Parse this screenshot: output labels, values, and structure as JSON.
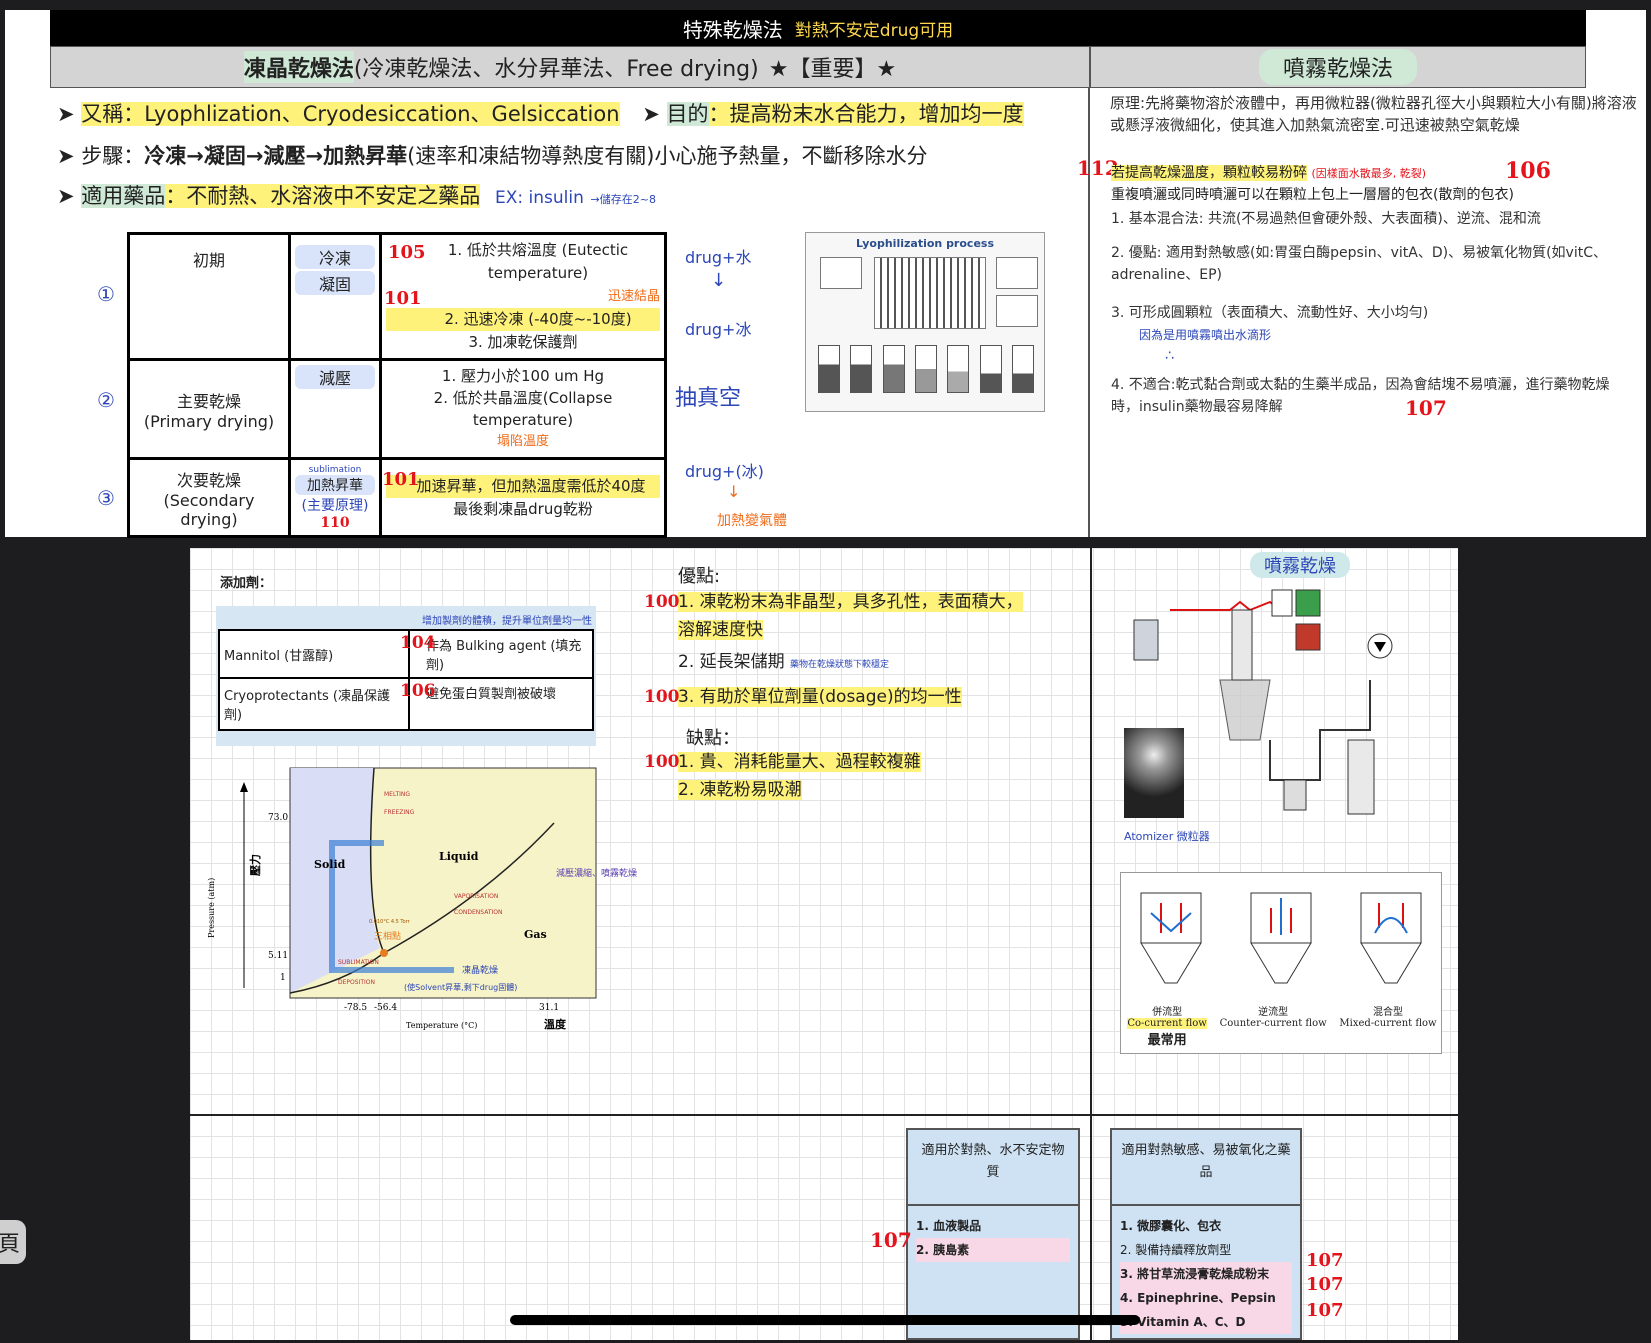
{
  "top": {
    "title": "特殊乾燥法",
    "title_note": "對熱不安定drug可用",
    "lyo_header_main": "凍晶乾燥法",
    "lyo_header_alt": "(冷凍乾燥法、水分昇華法、Free drying)",
    "lyo_header_star": "★【重要】★",
    "spray_header": "噴霧乾燥法",
    "alias_label": "又稱：",
    "alias_text": "Lyophlization、Cryodesiccation、Gelsiccation",
    "purpose_label": "目的",
    "purpose_text": "：提高粉末水合能力，增加均一度",
    "steps_label": "步驟：",
    "steps_bold": "冷凍→凝固→減壓→加熱昇華",
    "steps_rest": "(速率和凍結物導熱度有關)小心施予熱量，不斷移除水分",
    "drugs_label": "適用藥品",
    "drugs_text": "：不耐熱、水溶液中不安定之藥品",
    "drugs_note": "EX: insulin",
    "drugs_note2": "→儲存在2~8",
    "table": {
      "rows": [
        {
          "num": "①",
          "phase": "初期",
          "step1": "冷凍",
          "step2": "凝固",
          "note_num1": "105",
          "note_num2": "101",
          "desc1": "1. 低於共熔溫度 (Eutectic temperature)",
          "desc1_note": "迅速結晶",
          "desc2": "2. 迅速冷凍 (-40度~-10度)",
          "desc3": "3. 加凍乾保護劑"
        },
        {
          "num": "②",
          "phase": "主要乾燥",
          "phase2": "(Primary drying)",
          "step1": "減壓",
          "desc1": "1. 壓力小於100 um Hg",
          "desc2": "2. 低於共晶溫度(Collapse temperature)",
          "desc2_note": "塌陷溫度"
        },
        {
          "num": "③",
          "phase": "次要乾燥",
          "phase2": "(Secondary drying)",
          "step1": "加熱昇華",
          "step1_note": "sublimation",
          "step2": "(主要原理)",
          "step_num": "110",
          "note_num": "101",
          "desc1": "加速昇華，但加熱溫度需低於40度",
          "desc2": "最後剩凍晶drug乾粉"
        }
      ]
    },
    "drug_ice": "drug+冰",
    "drug_water": "drug+水",
    "vacuum_note": "抽真空",
    "drug_ice2": "drug+(冰)",
    "heat_note": "加熱變氣體",
    "lyo_process_title": "Lyophilization process",
    "spray": {
      "principle": "原理:先將藥物溶於液體中，再用微粒器(微粒器孔徑大小與顆粒大小有關)將溶液或懸浮液微細化，使其進入加熱氣流密室.可迅速被熱空氣乾燥",
      "num112": "112",
      "temp_note": "若提高乾燥溫度，顆粒較易粉碎",
      "temp_note_sm": "(因樣面水散最多, 乾裂)",
      "num106": "106",
      "coat_text": "重複噴灑或同時噴灑可以在顆粒上包上一層層的包衣(散劑的包衣)",
      "item1": "1.  基本混合法: 共流(不易過熱但會硬外殼、大表面積)、逆流、混和流",
      "item2": "2.  優點: 適用對熱敏感(如:胃蛋白酶pepsin、vitA、D)、易被氧化物質(如vitC、adrenaline、EP)",
      "item3": "3.  可形成圓顆粒（表面積大、流動性好、大小均勻)",
      "item3_note": "因為是用噴霧噴出水滴形",
      "item4": "4.  不適合:乾式黏合劑或太黏的生藥半成品，因為會結塊不易噴灑，進行藥物乾燥時，insulin藥物最容易降解",
      "num107": "107"
    }
  },
  "bottom": {
    "additive_title": "添加劑：",
    "additive_note": "增加製劑的體積，提升單位劑量均一性",
    "additive_rows": [
      {
        "name": "Mannitol (甘露醇)",
        "num": "104",
        "desc": "作為 Bulking agent (填充劑)"
      },
      {
        "name": "Cryoprotectants (凍晶保護劑)",
        "num": "106",
        "desc": "避免蛋白質製劑被破壞"
      }
    ],
    "phase": {
      "ylabel": "Pressure (atm)",
      "ylabel_note": "壓力",
      "xlabel": "Temperature (°C)",
      "xlabel_note": "溫度",
      "y_ticks": [
        "73.0",
        "5.11",
        "1"
      ],
      "x_ticks": [
        "-78.5",
        "-56.4",
        "31.1"
      ],
      "region_solid": "Solid",
      "region_liquid": "Liquid",
      "region_gas": "Gas",
      "melting": "MELTING",
      "freezing": "FREEZING",
      "vaporisation": "VAPORISATION",
      "condensation": "CONDENSATION",
      "sublimation": "SUBLIMATION",
      "deposition": "DEPOSITION",
      "triple_point": "三相點",
      "triple_label": "0.010°C 4.5 Torr",
      "note_liquid": "減壓濃縮、噴霧乾燥",
      "note_sub": "凍晶乾燥",
      "note_sub2": "(使Solvent昇華,剩下drug固體)"
    },
    "adv_title": "優點:",
    "adv": [
      {
        "num": "100",
        "text": "1.  凍乾粉末為非晶型，具多孔性，表面積大，溶解速度快"
      },
      {
        "num": "",
        "text": "2.  延長架儲期",
        "note": "藥物在乾燥狀態下較穩定"
      },
      {
        "num": "100",
        "text": "3.  有助於單位劑量(dosage)的均一性"
      }
    ],
    "dis_title": "缺點：",
    "dis": [
      {
        "num": "100",
        "text": "1.  貴、消耗能量大、過程較複雜"
      },
      {
        "num": "",
        "text": "2.  凍乾粉易吸潮"
      }
    ],
    "spray_title": "噴霧乾燥",
    "atomizer": "Atomizer 微粒器",
    "flow_types": [
      {
        "zh": "併流型",
        "en": "Co-current flow",
        "note": "最常用"
      },
      {
        "zh": "逆流型",
        "en": "Counter-current flow",
        "note": ""
      },
      {
        "zh": "混合型",
        "en": "Mixed-current flow",
        "note": ""
      }
    ],
    "table_left_title": "適用於對熱、水不安定物質",
    "table_left_items": [
      "1. 血液製品",
      "2. 胰島素"
    ],
    "table_left_num": "107",
    "table_right_title": "適用對熱敏感、易被氧化之藥品",
    "table_right_items": [
      "1. 微膠囊化、包衣",
      "2. 製備持續釋放劑型",
      "3. 將甘草流浸膏乾燥成粉末",
      "4. Epinephrine、Pepsin",
      "5. Vitamin A、C、D"
    ],
    "table_right_nums": [
      "107",
      "107",
      "107"
    ]
  },
  "side_tab": "頁"
}
